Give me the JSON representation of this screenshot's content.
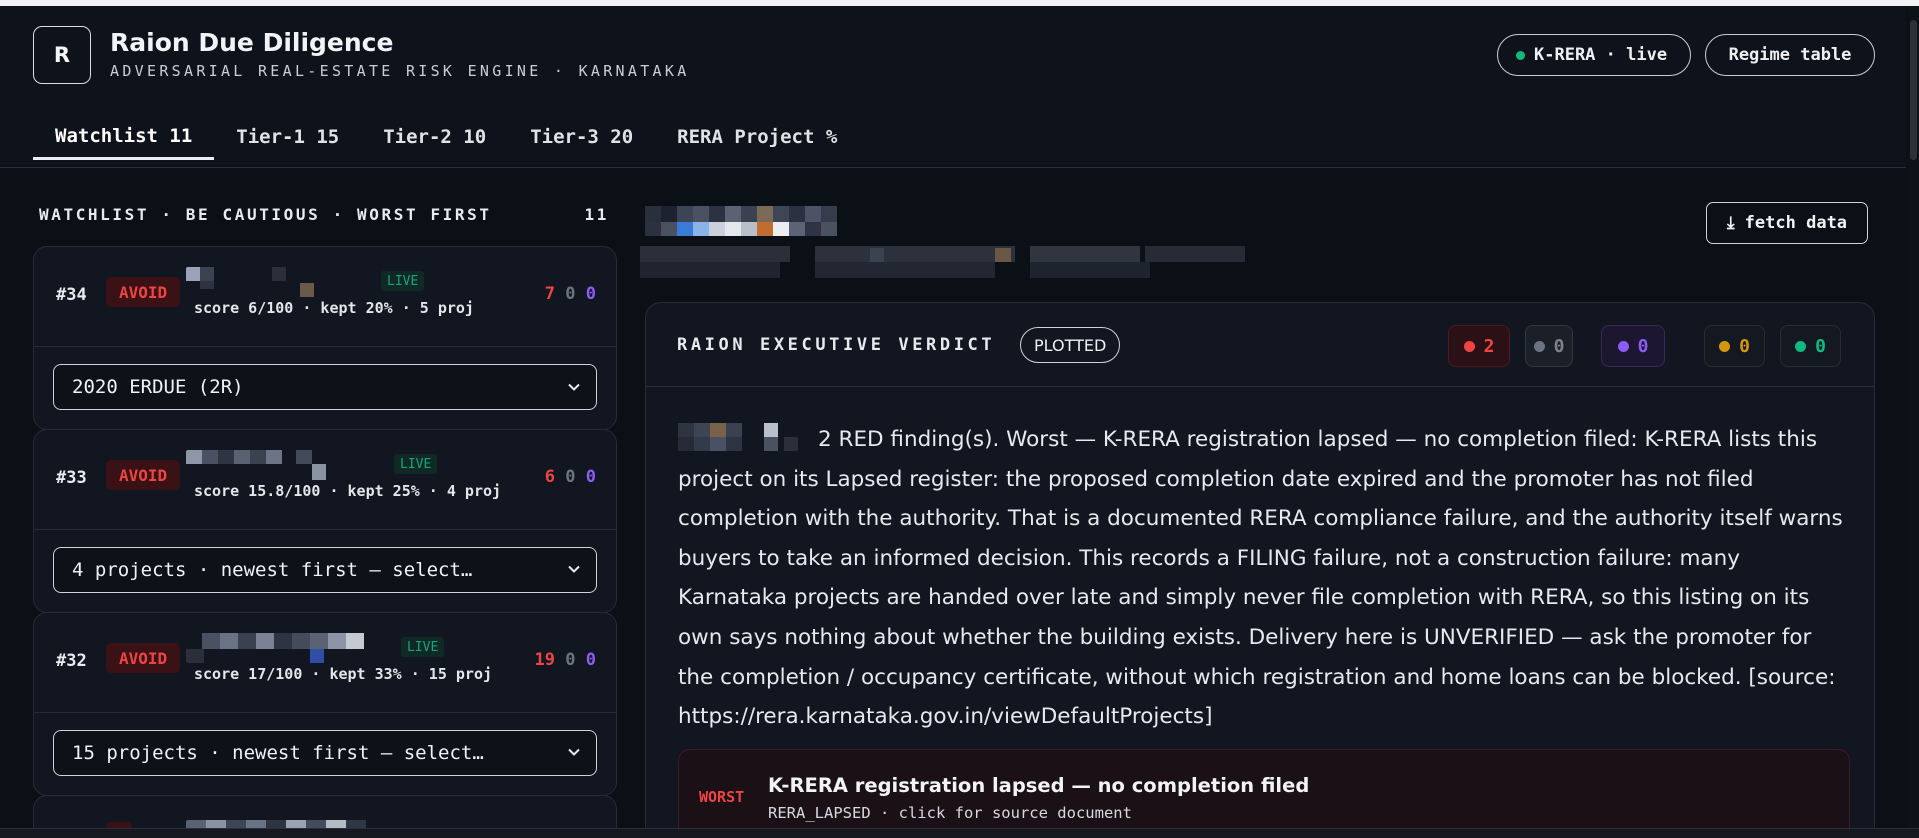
{
  "app": {
    "logo_letter": "R",
    "title": "Raion Due Diligence",
    "subtitle": "ADVERSARIAL REAL-ESTATE RISK ENGINE · KARNATAKA"
  },
  "header_actions": {
    "live_label": "K-RERA · live",
    "regime_label": "Regime table"
  },
  "tabs": [
    {
      "label": "Watchlist 11",
      "active": true
    },
    {
      "label": "Tier-1 15",
      "active": false
    },
    {
      "label": "Tier-2 10",
      "active": false
    },
    {
      "label": "Tier-3 20",
      "active": false
    },
    {
      "label": "RERA Project %",
      "active": false
    }
  ],
  "watchlist": {
    "heading": "WATCHLIST · BE CAUTIOUS · WORST FIRST",
    "count": "11",
    "cards": [
      {
        "rank": "#34",
        "verdict": "AVOID",
        "live": "LIVE",
        "score_line": "score 6/100 · kept 20% · 5 proj",
        "red": "7",
        "grey": "0",
        "violet": "0",
        "select_value": "2020                ERDUE (2R)"
      },
      {
        "rank": "#33",
        "verdict": "AVOID",
        "live": "LIVE",
        "score_line": "score 15.8/100 · kept 25% · 4 proj",
        "red": "6",
        "grey": "0",
        "violet": "0",
        "select_value": "4 projects · newest first — select…"
      },
      {
        "rank": "#32",
        "verdict": "AVOID",
        "live": "LIVE",
        "score_line": "score 17/100 · kept 33% · 15 proj",
        "red": "19",
        "grey": "0",
        "violet": "0",
        "select_value": "15 projects · newest first — select…"
      }
    ]
  },
  "detail": {
    "fetch_label": "⤓ fetch data",
    "verdict_title": "RAION EXECUTIVE VERDICT",
    "plotted_label": "PLOTTED",
    "stats": {
      "red": "2",
      "grey": "0",
      "violet": "0",
      "amber": "0",
      "green": "0"
    },
    "verdict_text": "2 RED finding(s). Worst — K-RERA registration lapsed — no completion filed: K-RERA lists this project on its Lapsed register: the proposed completion date expired and the promoter has not filed completion with the authority. That is a documented RERA compliance failure, and the authority itself warns buyers to take an informed decision. This records a FILING failure, not a construction failure: many Karnataka projects are handed over late and simply never file completion with RERA, so this listing on its own says nothing about whether the building exists. Delivery here is UNVERIFIED — ask the promoter for the completion / occupancy certificate, without which registration and home loans can be blocked. [source: https://rera.karnataka.gov.in/viewDefaultProjects]",
    "worst": {
      "label": "WORST",
      "title": "K-RERA registration lapsed — no completion filed",
      "subtitle": "RERA_LAPSED · click for source document"
    }
  },
  "colors": {
    "red": "#ef4444",
    "grey": "#6b7480",
    "violet": "#8b5cf6",
    "amber": "#d4960d",
    "green": "#10b981",
    "background": "#0b0f16",
    "panel": "#111620"
  }
}
